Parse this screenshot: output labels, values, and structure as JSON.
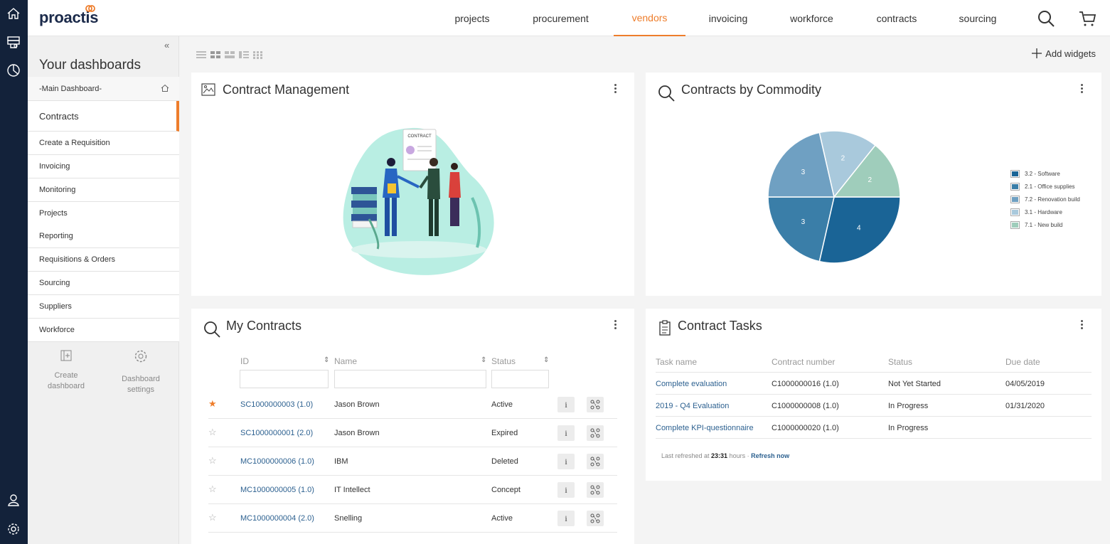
{
  "brand": {
    "name": "proactis"
  },
  "nav": {
    "items": [
      "projects",
      "procurement",
      "vendors",
      "invoicing",
      "workforce",
      "contracts",
      "sourcing"
    ],
    "active": "vendors"
  },
  "rail_icons": [
    "home-icon",
    "inbox-icon",
    "chart-icon",
    "user-icon",
    "settings-icon"
  ],
  "sidebar": {
    "collapse_label": "«",
    "title": "Your dashboards",
    "main_dashboard": "-Main Dashboard-",
    "items": [
      "Contracts",
      "Create a Requisition",
      "Invoicing",
      "Monitoring",
      "Projects",
      "Reporting",
      "Requisitions & Orders",
      "Sourcing",
      "Suppliers",
      "Workforce"
    ],
    "selected": "Contracts",
    "create_label_1": "Create",
    "create_label_2": "dashboard",
    "settings_label_1": "Dashboard",
    "settings_label_2": "settings"
  },
  "toolbar": {
    "add_widgets": "Add widgets"
  },
  "widgets": {
    "contract_management": {
      "title": "Contract Management",
      "illustration_text": "CONTRACT"
    },
    "contracts_by_commodity": {
      "title": "Contracts by Commodity"
    },
    "my_contracts": {
      "title": "My Contracts",
      "columns": [
        "ID",
        "Name",
        "Status"
      ],
      "rows": [
        {
          "starred": true,
          "id": "SC1000000003 (1.0)",
          "name": "Jason Brown",
          "status": "Active"
        },
        {
          "starred": false,
          "id": "SC1000000001 (2.0)",
          "name": "Jason Brown",
          "status": "Expired"
        },
        {
          "starred": false,
          "id": "MC1000000006 (1.0)",
          "name": "IBM",
          "status": "Deleted"
        },
        {
          "starred": false,
          "id": "MC1000000005 (1.0)",
          "name": "IT Intellect",
          "status": "Concept"
        },
        {
          "starred": false,
          "id": "MC1000000004 (2.0)",
          "name": "Snelling",
          "status": "Active"
        }
      ],
      "info_label": "i"
    },
    "contract_tasks": {
      "title": "Contract Tasks",
      "columns": [
        "Task name",
        "Contract number",
        "Status",
        "Due date"
      ],
      "rows": [
        {
          "task": "Complete evaluation",
          "contract": "C1000000016 (1.0)",
          "status": "Not Yet Started",
          "due": "04/05/2019"
        },
        {
          "task": "2019 - Q4 Evaluation",
          "contract": "C1000000008 (1.0)",
          "status": "In Progress",
          "due": "01/31/2020"
        },
        {
          "task": "Complete KPI-questionnaire",
          "contract": "C1000000020 (1.0)",
          "status": "In Progress",
          "due": ""
        }
      ],
      "refresh_prefix": "Last refreshed at ",
      "refresh_time": "23:31",
      "refresh_suffix": " hours · ",
      "refresh_link": "Refresh now"
    }
  },
  "chart_data": {
    "type": "pie",
    "title": "Contracts by Commodity",
    "slices": [
      {
        "label": "3.2 - Software",
        "value": 4,
        "color": "#1a6496"
      },
      {
        "label": "2.1 - Office supplies",
        "value": 3,
        "color": "#3a7ea8"
      },
      {
        "label": "7.2 - Renovation build",
        "value": 3,
        "color": "#6fa0c2"
      },
      {
        "label": "3.1 - Hardware",
        "value": 2,
        "color": "#a9c9dc"
      },
      {
        "label": "7.1 - New build",
        "value": 2,
        "color": "#9fcdbb"
      }
    ],
    "legend_position": "right"
  }
}
